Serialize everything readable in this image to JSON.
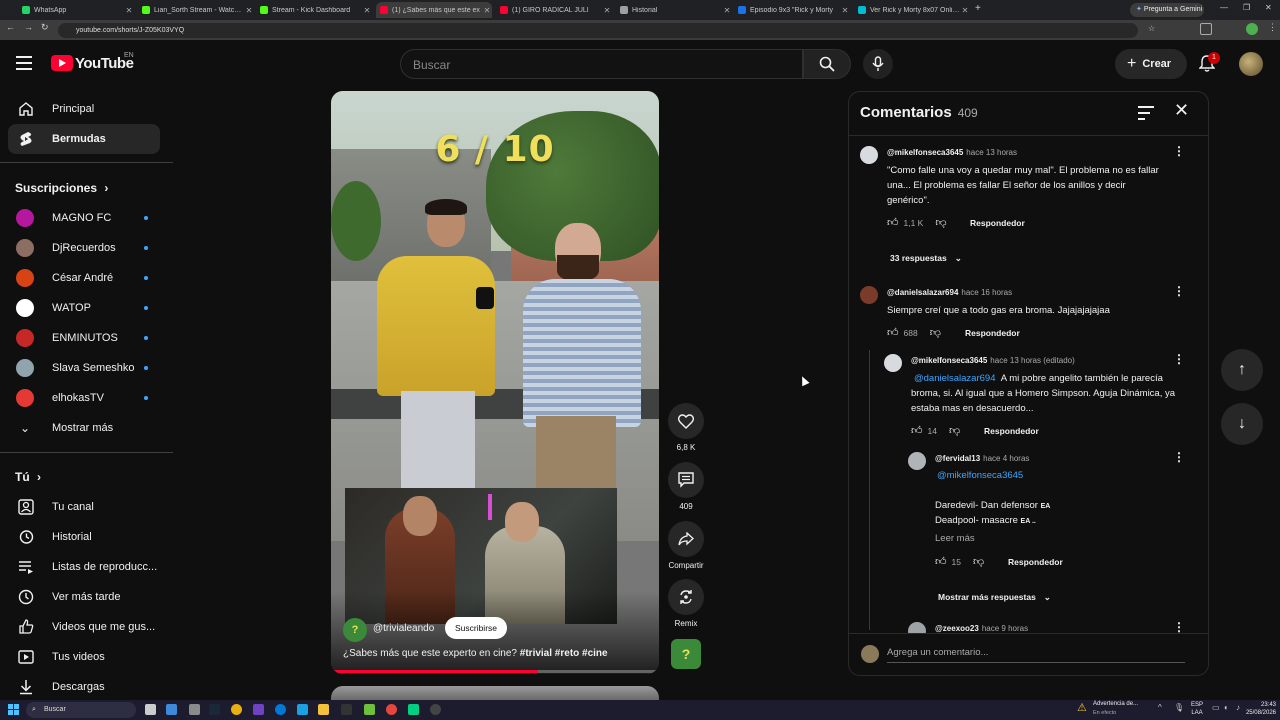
{
  "browser": {
    "tabs": [
      {
        "label": "WhatsApp",
        "color": "#25d366"
      },
      {
        "label": "Lian_Sorth Stream - Watch Live",
        "color": "#53fc18"
      },
      {
        "label": "Stream - Kick Dashboard",
        "color": "#53fc18"
      },
      {
        "label": "(1) ¿Sabes más que este ex",
        "color": "#ff0033"
      },
      {
        "label": "(1) GIRO RADICAL JULI",
        "color": "#ff0033"
      },
      {
        "label": "Historial",
        "color": "#9aa0a6"
      },
      {
        "label": "Episodio 9x3 \"Rick y Morty",
        "color": "#1a73e8"
      },
      {
        "label": "Ver Rick y Morty 8x07 Online H",
        "color": "#00bcd4"
      }
    ],
    "gemini_label": "Pregunta a Gemini",
    "url": "youtube.com/shorts/J-Z05K03VYQ"
  },
  "header": {
    "logo_text": "YouTube",
    "region": "EN",
    "search_placeholder": "Buscar",
    "create_label": "Crear",
    "notif_count": "1"
  },
  "sidebar": {
    "main": [
      {
        "label": "Principal",
        "icon": "home-icon"
      },
      {
        "label": "Bermudas",
        "icon": "shorts-icon"
      }
    ],
    "subs_title": "Suscripciones",
    "subs": [
      {
        "label": "MAGNO FC",
        "color": "#b5179e"
      },
      {
        "label": "DjRecuerdos",
        "color": "#8d6e63"
      },
      {
        "label": "César André",
        "color": "#d84315"
      },
      {
        "label": "WATOP",
        "color": "#ffffff"
      },
      {
        "label": "ENMINUTOS",
        "color": "#c62828"
      },
      {
        "label": "Slava Semeshko",
        "color": "#90a4ae"
      },
      {
        "label": "elhokasTV",
        "color": "#e53935"
      }
    ],
    "show_more": "Mostrar más",
    "you_title": "Tú",
    "you": [
      {
        "label": "Tu canal"
      },
      {
        "label": "Historial"
      },
      {
        "label": "Listas de reproducc..."
      },
      {
        "label": "Ver más tarde"
      },
      {
        "label": "Videos que me gus..."
      },
      {
        "label": "Tus videos"
      },
      {
        "label": "Descargas"
      }
    ]
  },
  "short": {
    "overlay_score": "6 / 10",
    "channel": "@trivialeando",
    "subscribe": "Suscribirse",
    "title": "¿Sabes más que este experto en cine?",
    "hashtags": "#trivial #reto #cine",
    "progress": 0.63,
    "likes": "6,8 K",
    "comments": "409",
    "share": "Compartir",
    "remix": "Remix"
  },
  "comments": {
    "title": "Comentarios",
    "count": "409",
    "items": [
      {
        "author": "@mikelfonseca3645",
        "time": "hace 13 horas",
        "text": "\"Como falle una voy a quedar muy mal\". El problema no es fallar una... El problema es fallar El señor de los anillos y decir genérico\".",
        "likes": "1,1 K",
        "reply": "Respondedor",
        "replies": "33 respuestas"
      },
      {
        "author": "@danielsalazar694",
        "time": "hace 16 horas",
        "text": "Siempre creí que a todo gas era broma. Jajajajajajaa",
        "likes": "688",
        "reply": "Respondedor"
      },
      {
        "author": "@mikelfonseca3645",
        "time": "hace 13 horas (editado)",
        "mention": "@danielsalazar694",
        "text": "A mi pobre angelito también le parecía broma, si. Al igual que a Homero Simpson. Aguja Dinámica, ya estaba mas en desacuerdo...",
        "likes": "14",
        "reply": "Respondedor"
      },
      {
        "author": "@fervidal13",
        "time": "hace 4 horas",
        "mention": "@mikelfonseca3645",
        "line1": "Daredevil- Dan defensor",
        "line1_tag": "EA",
        "line2": "Deadpool- masacre",
        "line2_tag": "EA ..",
        "read_more": "Leer más",
        "likes": "15",
        "reply": "Respondedor"
      },
      {
        "author": "@zeexoo23",
        "time": "hace 9 horas"
      }
    ],
    "more_replies": "Mostrar más respuestas",
    "add_placeholder": "Agrega un comentario..."
  },
  "taskbar": {
    "search": "Buscar",
    "warning_title": "Advertencia de...",
    "warning_sub": "En efecto",
    "lang1": "ESP",
    "lang2": "LAA",
    "time": "23:43",
    "date": "25/08/2026"
  }
}
